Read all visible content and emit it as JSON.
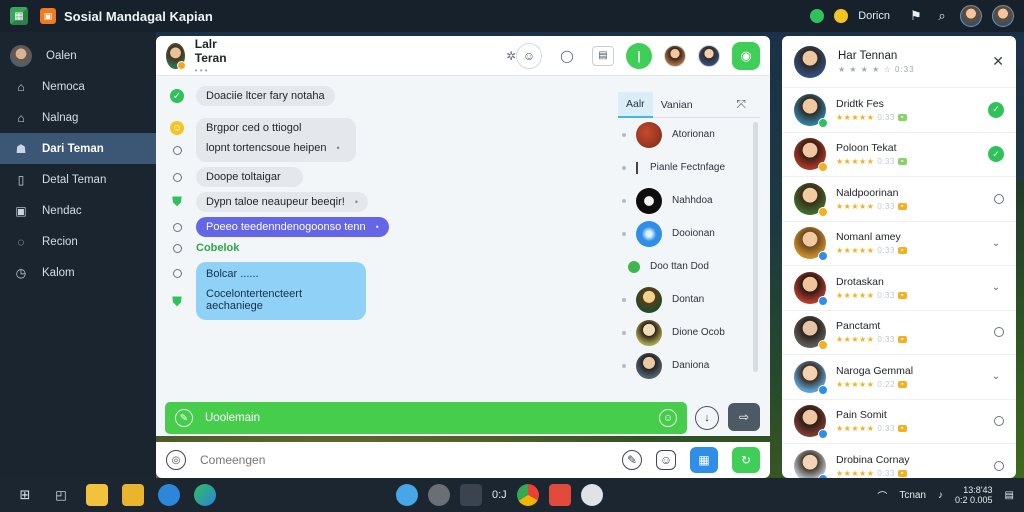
{
  "window": {
    "title": "Sosial Mandagal Kapian",
    "user_name": "Doricn"
  },
  "sidebar": {
    "items": [
      {
        "label": "Oalen",
        "icon": "avatar"
      },
      {
        "label": "Nemoca",
        "icon": "home-icon"
      },
      {
        "label": "Nalnag",
        "icon": "house-icon"
      },
      {
        "label": "Dari Teman",
        "icon": "people-icon",
        "active": true
      },
      {
        "label": "Detal Teman",
        "icon": "book-icon"
      },
      {
        "label": "Nendac",
        "icon": "image-icon"
      },
      {
        "label": "Recion",
        "icon": "chat-icon"
      },
      {
        "label": "Kalom",
        "icon": "clock-icon"
      }
    ]
  },
  "chat": {
    "name": "Lalr Teran",
    "subtitle": "• • •",
    "messages": [
      {
        "text": "Doaciie ltcer fary notaha",
        "mark": "green",
        "style": "grey"
      },
      {
        "text": "Brgpor ced o ttiogol",
        "mark": "yellow",
        "style": "grey"
      },
      {
        "text": "lopnt tortencsoue heipen",
        "mark": "ring",
        "style": "grey",
        "tail": "•"
      },
      {
        "text": "Doope toltaigar",
        "mark": "ring",
        "style": "grey"
      },
      {
        "text": "Dypn taloe neaupeur beeqir!",
        "mark": "shield",
        "style": "grey",
        "tail": "•"
      },
      {
        "text": "Poeeo teedenndenogoonso tenn",
        "mark": "ring",
        "style": "blue",
        "tail": "•"
      },
      {
        "text": "Cobelok",
        "mark": "ring",
        "style": "green-text"
      },
      {
        "text": "Bolcar ......",
        "mark": "ring",
        "style": "light-blue"
      },
      {
        "text": "Cocelontertencteert aechaniege",
        "mark": "shield",
        "style": "light-blue"
      }
    ],
    "members_tabs": [
      "Aalr",
      "Vanian"
    ],
    "members": [
      {
        "name": "Atorionan",
        "type": "avatar"
      },
      {
        "name": "Pianle Fectnfage",
        "type": "small"
      },
      {
        "name": "Nahhdoa",
        "type": "avatar"
      },
      {
        "name": "Dooionan",
        "type": "avatar"
      },
      {
        "name": "Doo ttan Dod",
        "type": "small"
      },
      {
        "name": "Dontan",
        "type": "avatar"
      },
      {
        "name": "Dione Ocob",
        "type": "avatar"
      },
      {
        "name": "Daniona",
        "type": "avatar"
      }
    ],
    "composer_text": "Uoolemain",
    "input_placeholder": "Comeengen"
  },
  "friends": {
    "header_name": "Har Tennan",
    "header_meta": "★ ★ ★ ★ ☆ 0:33",
    "list": [
      {
        "name": "Dridtk Fes",
        "meta": "0:33",
        "status": "online",
        "badge": "#2fc25a"
      },
      {
        "name": "Poloon Tekat",
        "meta": "0:33",
        "status": "online",
        "badge": "#f4b01e"
      },
      {
        "name": "Naldpoorinan",
        "meta": "0:33",
        "status": "ring",
        "badge": "#f4b01e"
      },
      {
        "name": "Nomanl amey",
        "meta": "0:33",
        "status": "chevron",
        "badge": "#2f8ee6"
      },
      {
        "name": "Drotaskan",
        "meta": "0:33",
        "status": "chevron",
        "badge": "#2f8ee6"
      },
      {
        "name": "Panctamt",
        "meta": "0:33",
        "status": "ring",
        "badge": "#f4b01e"
      },
      {
        "name": "Naroga Gemmal",
        "meta": "0:22",
        "status": "chevron",
        "badge": "#2f8ee6"
      },
      {
        "name": "Pain Somit",
        "meta": "0:33",
        "status": "ring",
        "badge": "#2f8ee6"
      },
      {
        "name": "Drobina Cornay",
        "meta": "0:33",
        "status": "ring",
        "badge": "#2f8ee6"
      }
    ]
  },
  "taskbar": {
    "center_label": "0:J",
    "tray_label": "Tcnan",
    "clock_time": "13:8'43",
    "clock_date": "0:2 0.005"
  }
}
